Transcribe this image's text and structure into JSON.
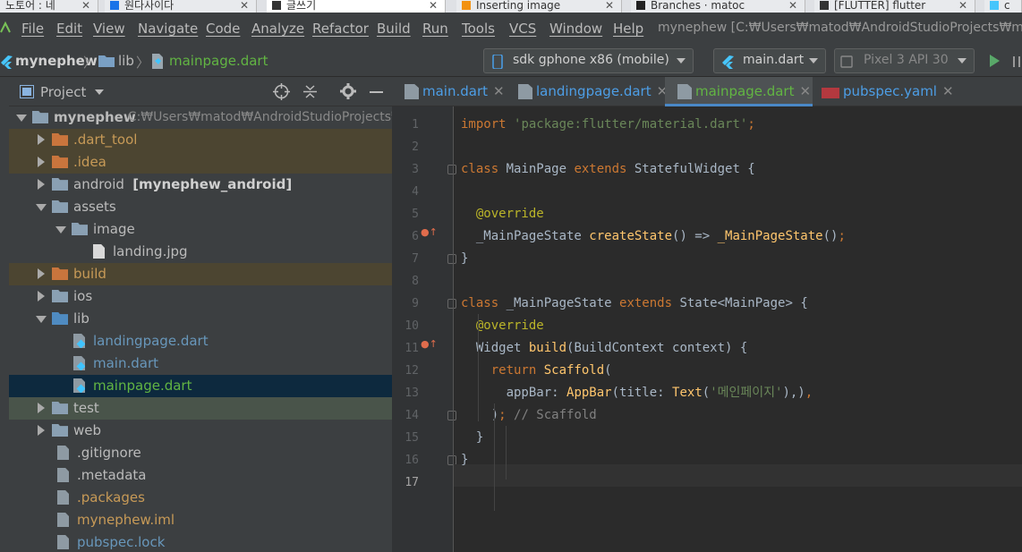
{
  "browser_tabs": [
    "노토어 : 네",
    "원다사이다",
    "글쓰기",
    "Inserting image",
    "Branches · matoc",
    "[FLUTTER] flutter",
    "c"
  ],
  "menu": {
    "items": [
      "File",
      "Edit",
      "View",
      "Navigate",
      "Code",
      "Analyze",
      "Refactor",
      "Build",
      "Run",
      "Tools",
      "VCS",
      "Window",
      "Help"
    ],
    "title": "mynephew [C:₩Users₩matod₩AndroidStudioProjects₩myne"
  },
  "breadcrumbs": [
    "mynephew",
    "lib",
    "mainpage.dart"
  ],
  "toolbar": {
    "device": "sdk gphone x86 (mobile)",
    "run_config": "main.dart",
    "avd": "Pixel 3 API 30"
  },
  "project_panel": {
    "title": "Project"
  },
  "tree": [
    {
      "label": "mynephew",
      "extra": "C:₩Users₩matod₩AndroidStudioProjects₩",
      "depth": 0,
      "open": true,
      "color": "#bbbbbb",
      "bold": true
    },
    {
      "label": ".dart_tool",
      "depth": 1,
      "open": false,
      "color": "#c79a57",
      "bg": "#4c4531"
    },
    {
      "label": ".idea",
      "depth": 1,
      "open": false,
      "color": "#c79a57",
      "bg": "#4c4531"
    },
    {
      "label": "android",
      "extra": "[mynephew_android]",
      "depth": 1,
      "open": false,
      "color": "#bbbbbb"
    },
    {
      "label": "assets",
      "depth": 1,
      "open": true,
      "color": "#bbbbbb"
    },
    {
      "label": "image",
      "depth": 2,
      "open": true,
      "color": "#bbbbbb"
    },
    {
      "label": "landing.jpg",
      "depth": 3,
      "leaf": true,
      "color": "#bbbbbb"
    },
    {
      "label": "build",
      "depth": 1,
      "open": false,
      "color": "#c79a57",
      "bg": "#4c4531"
    },
    {
      "label": "ios",
      "depth": 1,
      "open": false,
      "color": "#bbbbbb"
    },
    {
      "label": "lib",
      "depth": 1,
      "open": true,
      "color": "#bbbbbb"
    },
    {
      "label": "landingpage.dart",
      "depth": 2,
      "leaf": true,
      "color": "#6897bb"
    },
    {
      "label": "main.dart",
      "depth": 2,
      "leaf": true,
      "color": "#6897bb"
    },
    {
      "label": "mainpage.dart",
      "depth": 2,
      "leaf": true,
      "color": "#62b543",
      "selected": true
    },
    {
      "label": "test",
      "depth": 1,
      "open": false,
      "color": "#bbbbbb",
      "bg": "#49544a"
    },
    {
      "label": "web",
      "depth": 1,
      "open": false,
      "color": "#bbbbbb"
    },
    {
      "label": ".gitignore",
      "depth": 1,
      "leaf": true,
      "color": "#bbbbbb"
    },
    {
      "label": ".metadata",
      "depth": 1,
      "leaf": true,
      "color": "#bbbbbb"
    },
    {
      "label": ".packages",
      "depth": 1,
      "leaf": true,
      "color": "#c79a57"
    },
    {
      "label": "mynephew.iml",
      "depth": 1,
      "leaf": true,
      "color": "#c79a57"
    },
    {
      "label": "pubspec.lock",
      "depth": 1,
      "leaf": true,
      "color": "#6897bb"
    }
  ],
  "editor_tabs": [
    {
      "label": "main.dart",
      "active": false
    },
    {
      "label": "landingpage.dart",
      "active": false
    },
    {
      "label": "mainpage.dart",
      "active": true
    },
    {
      "label": "pubspec.yaml",
      "active": false
    }
  ],
  "line_numbers": [
    "1",
    "2",
    "3",
    "4",
    "5",
    "6",
    "7",
    "8",
    "9",
    "10",
    "11",
    "12",
    "13",
    "14",
    "15",
    "16",
    "17"
  ],
  "code_lines": [
    [
      [
        "k",
        "import "
      ],
      [
        "s",
        "'package:flutter/material.dart'"
      ],
      [
        "k",
        ";"
      ]
    ],
    [],
    [
      [
        "k",
        "class "
      ],
      [
        "p",
        "MainPage "
      ],
      [
        "k",
        "extends "
      ],
      [
        "p",
        "StatefulWidget {"
      ]
    ],
    [],
    [
      [
        "a",
        "  @override"
      ]
    ],
    [
      [
        "p",
        "  _MainPageState "
      ],
      [
        "f",
        "createState"
      ],
      [
        "p",
        "() => "
      ],
      [
        "f",
        "_MainPageState"
      ],
      [
        "p",
        "()"
      ],
      [
        "k",
        ";"
      ]
    ],
    [
      [
        "p",
        "}"
      ]
    ],
    [],
    [
      [
        "k",
        "class "
      ],
      [
        "p",
        "_MainPageState "
      ],
      [
        "k",
        "extends "
      ],
      [
        "p",
        "State<MainPage> {"
      ]
    ],
    [
      [
        "a",
        "  @override"
      ]
    ],
    [
      [
        "p",
        "  Widget "
      ],
      [
        "f",
        "build"
      ],
      [
        "p",
        "(BuildContext context) {"
      ]
    ],
    [
      [
        "k",
        "    return "
      ],
      [
        "f",
        "Scaffold"
      ],
      [
        "p",
        "("
      ]
    ],
    [
      [
        "p",
        "      appBar: "
      ],
      [
        "f",
        "AppBar"
      ],
      [
        "p",
        "(title: "
      ],
      [
        "f",
        "Text"
      ],
      [
        "p",
        "("
      ],
      [
        "s",
        "'메인페이지'"
      ],
      [
        "p",
        "),)"
      ],
      [
        "k",
        ","
      ]
    ],
    [
      [
        "p",
        "    )"
      ],
      [
        "k",
        "; "
      ],
      [
        "c",
        "// Scaffold"
      ]
    ],
    [
      [
        "p",
        "  }"
      ]
    ],
    [
      [
        "p",
        "}"
      ]
    ],
    []
  ]
}
